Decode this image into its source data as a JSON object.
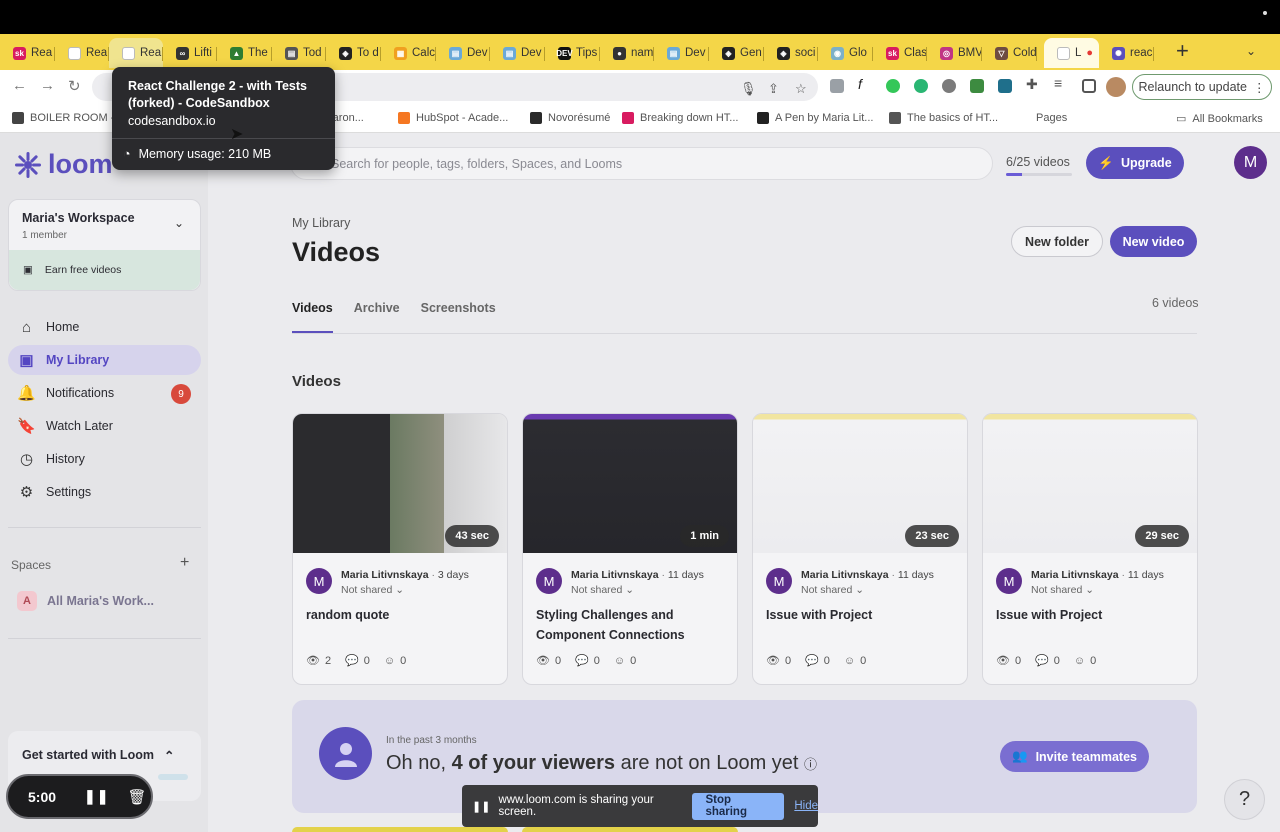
{
  "browser": {
    "tabs": [
      {
        "label": "Rea",
        "icon_color": "#d81b60",
        "icon_text": "sk"
      },
      {
        "label": "Rea",
        "icon_color": "#ffffff",
        "icon_text": ""
      },
      {
        "label": "Rea",
        "icon_color": "#ffffff",
        "icon_text": ""
      },
      {
        "label": "Lifti",
        "icon_color": "#333333",
        "icon_text": "∞"
      },
      {
        "label": "The",
        "icon_color": "#2e7d32",
        "icon_text": "▲"
      },
      {
        "label": "Tod",
        "icon_color": "#555555",
        "icon_text": "▤"
      },
      {
        "label": "To d",
        "icon_color": "#222222",
        "icon_text": "◈"
      },
      {
        "label": "Calc",
        "icon_color": "#f0a020",
        "icon_text": "▦"
      },
      {
        "label": "Dev",
        "icon_color": "#6aa9d8",
        "icon_text": "▤"
      },
      {
        "label": "Dev",
        "icon_color": "#6aa9d8",
        "icon_text": "▤"
      },
      {
        "label": "Tips",
        "icon_color": "#111111",
        "icon_text": "DEV"
      },
      {
        "label": "nam",
        "icon_color": "#333333",
        "icon_text": "●"
      },
      {
        "label": "Dev",
        "icon_color": "#6aa9d8",
        "icon_text": "▤"
      },
      {
        "label": "Gen",
        "icon_color": "#222222",
        "icon_text": "◈"
      },
      {
        "label": "soci",
        "icon_color": "#222222",
        "icon_text": "◈"
      },
      {
        "label": "Glo",
        "icon_color": "#7cb0c8",
        "icon_text": "◉"
      },
      {
        "label": "Clas",
        "icon_color": "#d81b60",
        "icon_text": "sk"
      },
      {
        "label": "BMV",
        "icon_color": "#c13584",
        "icon_text": "◎"
      },
      {
        "label": "Cold",
        "icon_color": "#6d4c41",
        "icon_text": "▽"
      },
      {
        "label": "L",
        "icon_color": "#ffffff",
        "icon_text": ""
      },
      {
        "label": "reac",
        "icon_color": "#5b4fbd",
        "icon_text": "✺"
      }
    ],
    "relaunch_label": "Relaunch to update",
    "bookmarks": [
      {
        "label": "BOILER ROOM -",
        "color": "#444444"
      },
      {
        "label": "a saron...",
        "color": "#999999"
      },
      {
        "label": "HubSpot - Acade...",
        "color": "#f57722"
      },
      {
        "label": "Novorésumé",
        "color": "#2a2a2a"
      },
      {
        "label": "Breaking down HT...",
        "color": "#d81b60"
      },
      {
        "label": "A Pen by Maria Lit...",
        "color": "#222222"
      },
      {
        "label": "The basics of HT...",
        "color": "#555555"
      },
      {
        "label": "Pages",
        "color": "#555555"
      }
    ],
    "all_bookmarks": "All Bookmarks"
  },
  "tooltip": {
    "title": "React Challenge 2 - with Tests (forked) - CodeSandbox",
    "url": "codesandbox.io",
    "memory": "Memory usage: 210 MB"
  },
  "sidebar": {
    "brand": "loom",
    "workspace_name": "Maria's Workspace",
    "workspace_members": "1 member",
    "earn": "Earn free videos",
    "nav": [
      {
        "label": "Home",
        "icon": "home-icon"
      },
      {
        "label": "My Library",
        "icon": "library-icon"
      },
      {
        "label": "Notifications",
        "icon": "bell-icon",
        "badge": "9"
      },
      {
        "label": "Watch Later",
        "icon": "bookmark-icon"
      },
      {
        "label": "History",
        "icon": "history-icon"
      },
      {
        "label": "Settings",
        "icon": "gear-icon"
      }
    ],
    "spaces_heading": "Spaces",
    "space_item": "All Maria's Work...",
    "space_initial": "A",
    "get_started": "Get started with Loom"
  },
  "recorder": {
    "time": "5:00"
  },
  "header": {
    "search_placeholder": "Search for people, tags, folders, Spaces, and Looms",
    "video_count": "6/25 videos",
    "video_fraction": 0.24,
    "upgrade": "Upgrade",
    "avatar_initial": "M"
  },
  "library": {
    "breadcrumb": "My Library",
    "title": "Videos",
    "new_folder": "New folder",
    "new_video": "New video",
    "tabs": [
      "Videos",
      "Archive",
      "Screenshots"
    ],
    "count": "6 videos",
    "section": "Videos",
    "cards": [
      {
        "duration": "43 sec",
        "author": "Maria Litivnskaya",
        "age": "3 days",
        "sharing": "Not shared",
        "title": "random quote",
        "views": "2",
        "comments": "0",
        "reactions": "0"
      },
      {
        "duration": "1 min",
        "author": "Maria Litivnskaya",
        "age": "11 days",
        "sharing": "Not shared",
        "title": "Styling Challenges and Component Connections",
        "views": "0",
        "comments": "0",
        "reactions": "0"
      },
      {
        "duration": "23 sec",
        "author": "Maria Litivnskaya",
        "age": "11 days",
        "sharing": "Not shared",
        "title": "Issue with Project",
        "views": "0",
        "comments": "0",
        "reactions": "0"
      },
      {
        "duration": "29 sec",
        "author": "Maria Litivnskaya",
        "age": "11 days",
        "sharing": "Not shared",
        "title": "Issue with Project",
        "views": "0",
        "comments": "0",
        "reactions": "0"
      }
    ]
  },
  "promo": {
    "subtitle": "In the past 3 months",
    "text_pre": "Oh no,",
    "text_bold": "4 of your viewers",
    "text_post": "are not on Loom yet",
    "invite": "Invite teammates"
  },
  "sharebar": {
    "message": "www.loom.com is sharing your screen.",
    "stop": "Stop sharing",
    "hide": "Hide"
  },
  "colors": {
    "accent": "#5b4fbd",
    "tab_strip": "#f4d648",
    "badge": "#d8493c"
  }
}
